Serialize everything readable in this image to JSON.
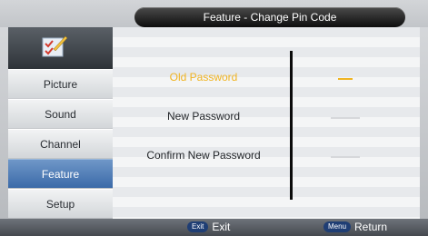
{
  "header": {
    "title": "Feature - Change Pin Code"
  },
  "sidebar": {
    "items": [
      {
        "label": "Picture"
      },
      {
        "label": "Sound"
      },
      {
        "label": "Channel"
      },
      {
        "label": "Feature",
        "active": true
      },
      {
        "label": "Setup"
      }
    ]
  },
  "form": {
    "rows": [
      {
        "label": "Old Password",
        "active": true,
        "value": "_ _ _ _"
      },
      {
        "label": "New Password",
        "value": ""
      },
      {
        "label": "Confirm New Password",
        "value": ""
      }
    ]
  },
  "footer": {
    "exit_key": "Exit",
    "exit_label": "Exit",
    "menu_key": "Menu",
    "menu_label": "Return"
  },
  "colors": {
    "accent": "#3b6aa8",
    "highlight": "#f0b422"
  },
  "icons": {
    "logo": "checklist-pencil-icon"
  }
}
